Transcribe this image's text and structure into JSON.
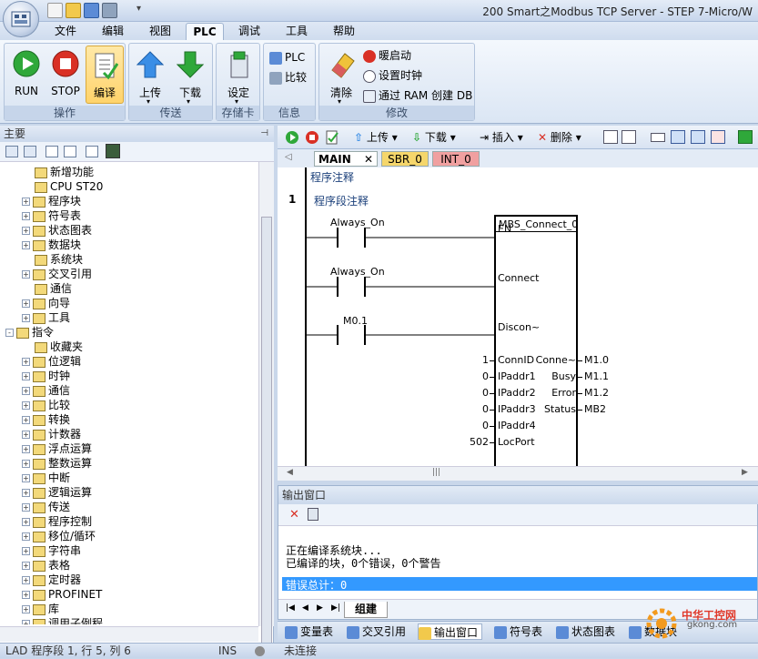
{
  "window": {
    "title": "200 Smart之Modbus TCP Server - STEP 7-Micro/W"
  },
  "menu_tabs": [
    "文件",
    "编辑",
    "视图",
    "PLC",
    "调试",
    "工具",
    "帮助"
  ],
  "active_tab": "PLC",
  "ribbon": {
    "groups": [
      "操作",
      "传送",
      "存储卡",
      "信息",
      "修改"
    ],
    "run": "RUN",
    "stop": "STOP",
    "compile": "编译",
    "upload": "上传",
    "download": "下载",
    "settings": "设定",
    "plc": "PLC",
    "compare": "比较",
    "clear": "清除",
    "warm_start": "暖启动",
    "set_clock": "设置时钟",
    "create_ram_db": "通过 RAM 创建 DB"
  },
  "left_pane": {
    "title": "主要",
    "tree": [
      {
        "label": "新增功能",
        "expand": ""
      },
      {
        "label": "CPU ST20",
        "expand": ""
      },
      {
        "label": "程序块",
        "expand": "+"
      },
      {
        "label": "符号表",
        "expand": "+"
      },
      {
        "label": "状态图表",
        "expand": "+"
      },
      {
        "label": "数据块",
        "expand": "+"
      },
      {
        "label": "系统块",
        "expand": ""
      },
      {
        "label": "交叉引用",
        "expand": "+"
      },
      {
        "label": "通信",
        "expand": ""
      },
      {
        "label": "向导",
        "expand": "+"
      },
      {
        "label": "工具",
        "expand": "+"
      },
      {
        "label": "指令",
        "expand": "-"
      },
      {
        "label": "收藏夹",
        "expand": ""
      },
      {
        "label": "位逻辑",
        "expand": "+"
      },
      {
        "label": "时钟",
        "expand": "+"
      },
      {
        "label": "通信",
        "expand": "+"
      },
      {
        "label": "比较",
        "expand": "+"
      },
      {
        "label": "转换",
        "expand": "+"
      },
      {
        "label": "计数器",
        "expand": "+"
      },
      {
        "label": "浮点运算",
        "expand": "+"
      },
      {
        "label": "整数运算",
        "expand": "+"
      },
      {
        "label": "中断",
        "expand": "+"
      },
      {
        "label": "逻辑运算",
        "expand": "+"
      },
      {
        "label": "传送",
        "expand": "+"
      },
      {
        "label": "程序控制",
        "expand": "+"
      },
      {
        "label": "移位/循环",
        "expand": "+"
      },
      {
        "label": "字符串",
        "expand": "+"
      },
      {
        "label": "表格",
        "expand": "+"
      },
      {
        "label": "定时器",
        "expand": "+"
      },
      {
        "label": "PROFINET",
        "expand": "+"
      },
      {
        "label": "库",
        "expand": "+"
      },
      {
        "label": "调用子例程",
        "expand": "+"
      }
    ]
  },
  "editor": {
    "toolbar": {
      "upload": "上传",
      "download": "下载",
      "insert": "插入",
      "delete": "删除"
    },
    "tabs": [
      "MAIN",
      "SBR_0",
      "INT_0"
    ],
    "program_comment": "程序注释",
    "network_number": "1",
    "network_comment": "程序段注释",
    "contacts": [
      "Always_On",
      "Always_On",
      "M0.1"
    ],
    "block": {
      "name": "MBS_Connect_0",
      "inputs": [
        {
          "pin": "EN",
          "value": ""
        },
        {
          "pin": "Connect",
          "value": ""
        },
        {
          "pin": "Discon~",
          "value": ""
        },
        {
          "pin": "ConnID",
          "value": "1"
        },
        {
          "pin": "IPaddr1",
          "value": "0"
        },
        {
          "pin": "IPaddr2",
          "value": "0"
        },
        {
          "pin": "IPaddr3",
          "value": "0"
        },
        {
          "pin": "IPaddr4",
          "value": "0"
        },
        {
          "pin": "LocPort",
          "value": "502"
        }
      ],
      "outputs": [
        {
          "pin": "Conne~",
          "value": "M1.0"
        },
        {
          "pin": "Busy",
          "value": "M1.1"
        },
        {
          "pin": "Error",
          "value": "M1.2"
        },
        {
          "pin": "Status",
          "value": "MB2"
        }
      ]
    }
  },
  "output": {
    "title": "输出窗口",
    "lines": [
      "正在编译系统块...",
      "已编译的块，0个错误，0个警告"
    ],
    "error_total": "错误总计：0",
    "tab": "组建"
  },
  "bottom_tabs": [
    "变量表",
    "交叉引用",
    "输出窗口",
    "符号表",
    "状态图表",
    "数据块"
  ],
  "watermark": {
    "text": "中华工控网",
    "url": "gkong.com"
  },
  "status": {
    "position": "LAD 程序段 1, 行 5, 列 6",
    "mode": "INS",
    "connection": "未连接"
  }
}
